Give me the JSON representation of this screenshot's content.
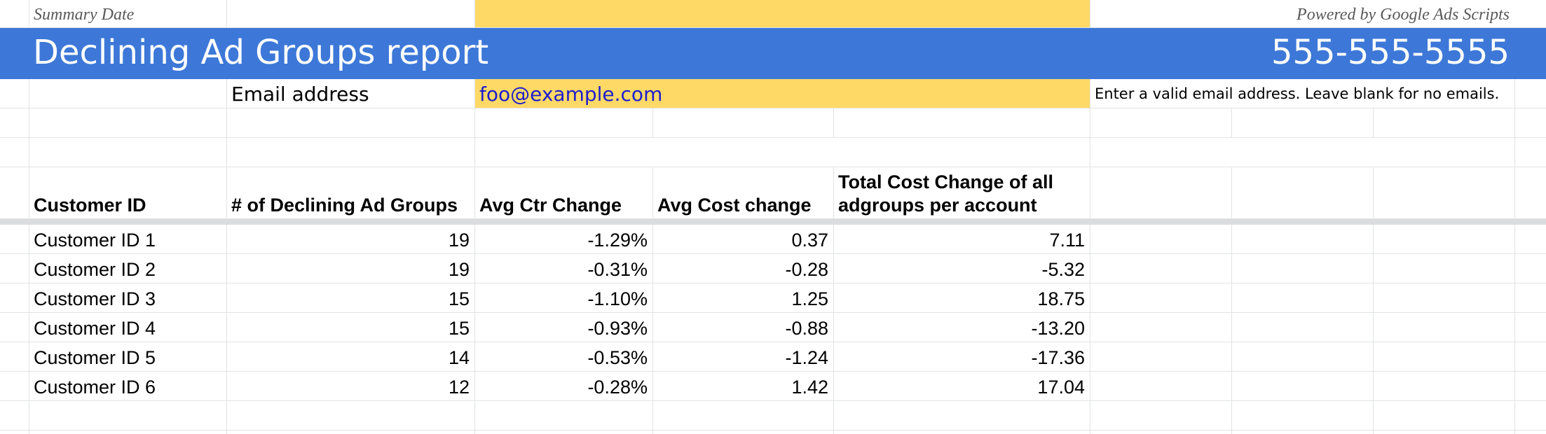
{
  "top_row": {
    "summary_date_label": "Summary Date",
    "powered_by": "Powered by Google Ads Scripts"
  },
  "banner": {
    "title": "Declining Ad Groups report",
    "phone": "555-555-5555"
  },
  "email_row": {
    "label": "Email address",
    "value": "foo@example.com",
    "note": "Enter a valid email address. Leave blank for no emails."
  },
  "table": {
    "headers": {
      "customer_id": "Customer ID",
      "declining_groups": "# of Declining Ad Groups",
      "avg_ctr_change": "Avg Ctr Change",
      "avg_cost_change": "Avg Cost change",
      "total_cost_change": "Total Cost Change of all adgroups per account"
    },
    "rows": [
      {
        "customer_id": "Customer ID 1",
        "declining_groups": "19",
        "avg_ctr_change": "-1.29%",
        "avg_cost_change": "0.37",
        "total_cost_change": "7.11"
      },
      {
        "customer_id": "Customer ID 2",
        "declining_groups": "19",
        "avg_ctr_change": "-0.31%",
        "avg_cost_change": "-0.28",
        "total_cost_change": "-5.32"
      },
      {
        "customer_id": "Customer ID 3",
        "declining_groups": "15",
        "avg_ctr_change": "-1.10%",
        "avg_cost_change": "1.25",
        "total_cost_change": "18.75"
      },
      {
        "customer_id": "Customer ID 4",
        "declining_groups": "15",
        "avg_ctr_change": "-0.93%",
        "avg_cost_change": "-0.88",
        "total_cost_change": "-13.20"
      },
      {
        "customer_id": "Customer ID 5",
        "declining_groups": "14",
        "avg_ctr_change": "-0.53%",
        "avg_cost_change": "-1.24",
        "total_cost_change": "-17.36"
      },
      {
        "customer_id": "Customer ID 6",
        "declining_groups": "12",
        "avg_ctr_change": "-0.28%",
        "avg_cost_change": "1.42",
        "total_cost_change": "17.04"
      }
    ]
  },
  "colors": {
    "banner": "#3d78d8",
    "highlight": "#ffd966",
    "email_link": "#1c1ccf",
    "gridline": "#e2e3e3"
  }
}
